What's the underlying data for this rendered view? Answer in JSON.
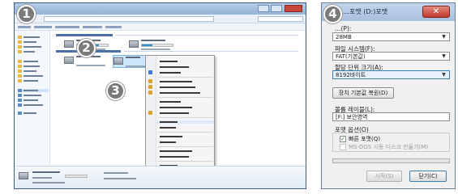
{
  "steps": {
    "one": "1",
    "two": "2",
    "three": "3",
    "four": "4"
  },
  "format_dialog": {
    "title": "…포맷 (D:)포맷",
    "close_label": "✕",
    "capacity_label": "…(P):",
    "capacity_value": "28MB",
    "filesystem_label": "파일 시스템(F):",
    "filesystem_value": "FAT(기본값)",
    "allocation_label": "할당 단위 크기(A):",
    "allocation_value": "8192바이트",
    "restore_defaults_button": "장치 기본값 복원(D)",
    "volume_label_label": "볼륨 레이블(L):",
    "volume_label_value": "[F:] 보안영역",
    "format_options_label": "포맷 옵션(O)",
    "quick_format_label": "빠른 포맷(Q)",
    "quick_format_checked": true,
    "msdos_label": "MS-DOS 시동 디스크 만들기(M)",
    "msdos_checked": false,
    "start_button": "시작(S)",
    "close_button": "닫기(C)"
  }
}
